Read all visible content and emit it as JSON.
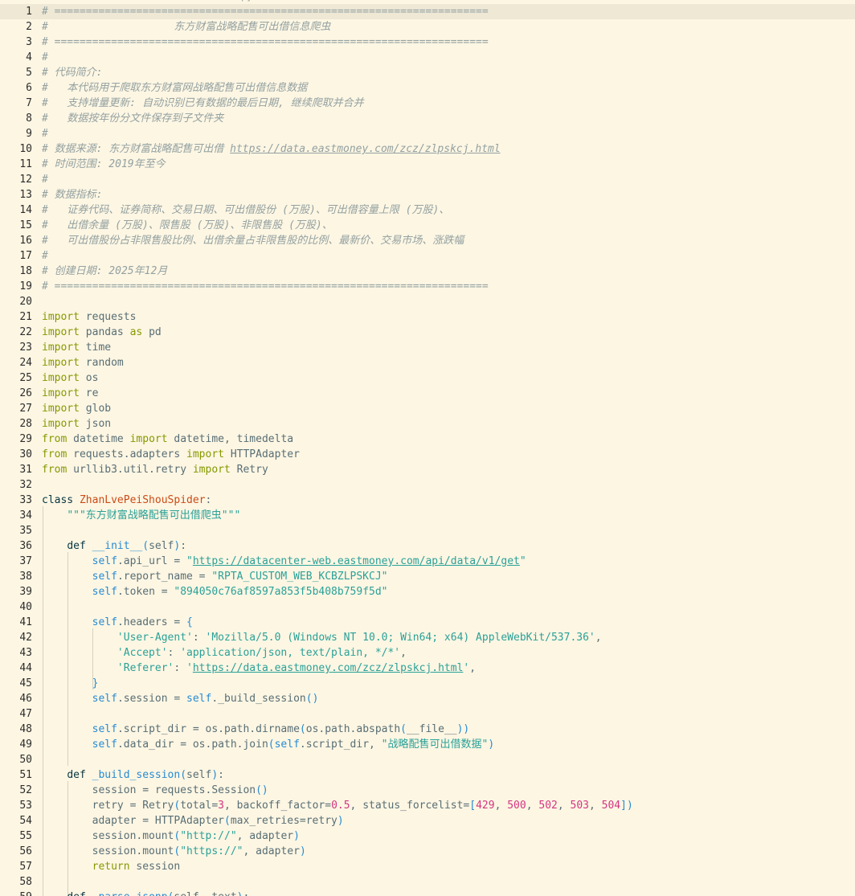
{
  "editor": {
    "language": "python",
    "current_line": 1,
    "top_fragment": "py",
    "lines": [
      [
        [
          "c",
          "# ====================================================================="
        ]
      ],
      [
        [
          "c",
          "#                    东方财富战略配售可出借信息爬虫"
        ]
      ],
      [
        [
          "c",
          "# ====================================================================="
        ]
      ],
      [
        [
          "c",
          "#"
        ]
      ],
      [
        [
          "c",
          "# 代码简介:"
        ]
      ],
      [
        [
          "c",
          "#   本代码用于爬取东方财富网战略配售可出借信息数据"
        ]
      ],
      [
        [
          "c",
          "#   支持增量更新: 自动识别已有数据的最后日期, 继续爬取并合并"
        ]
      ],
      [
        [
          "c",
          "#   数据按年份分文件保存到子文件夹"
        ]
      ],
      [
        [
          "c",
          "#"
        ]
      ],
      [
        [
          "c",
          "# 数据来源: 东方财富战略配售可出借 "
        ],
        [
          "cu",
          "https://data.eastmoney.com/zcz/zlpskcj.html"
        ]
      ],
      [
        [
          "c",
          "# 时间范围: 2019年至今"
        ]
      ],
      [
        [
          "c",
          "#"
        ]
      ],
      [
        [
          "c",
          "# 数据指标:"
        ]
      ],
      [
        [
          "c",
          "#   证券代码、证券简称、交易日期、可出借股份 (万股)、可出借容量上限 (万股)、"
        ]
      ],
      [
        [
          "c",
          "#   出借余量 (万股)、限售股 (万股)、非限售股 (万股)、"
        ]
      ],
      [
        [
          "c",
          "#   可出借股份占非限售股比例、出借余量占非限售股的比例、最新价、交易市场、涨跌幅"
        ]
      ],
      [
        [
          "c",
          "#"
        ]
      ],
      [
        [
          "c",
          "# 创建日期: 2025年12月"
        ]
      ],
      [
        [
          "c",
          "# ====================================================================="
        ]
      ],
      [],
      [
        [
          "k",
          "import"
        ],
        [
          "t",
          " requests"
        ]
      ],
      [
        [
          "k",
          "import"
        ],
        [
          "t",
          " pandas "
        ],
        [
          "k",
          "as"
        ],
        [
          "t",
          " pd"
        ]
      ],
      [
        [
          "k",
          "import"
        ],
        [
          "t",
          " time"
        ]
      ],
      [
        [
          "k",
          "import"
        ],
        [
          "t",
          " random"
        ]
      ],
      [
        [
          "k",
          "import"
        ],
        [
          "t",
          " os"
        ]
      ],
      [
        [
          "k",
          "import"
        ],
        [
          "t",
          " re"
        ]
      ],
      [
        [
          "k",
          "import"
        ],
        [
          "t",
          " glob"
        ]
      ],
      [
        [
          "k",
          "import"
        ],
        [
          "t",
          " json"
        ]
      ],
      [
        [
          "k",
          "from"
        ],
        [
          "t",
          " datetime "
        ],
        [
          "k",
          "import"
        ],
        [
          "t",
          " datetime, timedelta"
        ]
      ],
      [
        [
          "k",
          "from"
        ],
        [
          "t",
          " requests.adapters "
        ],
        [
          "k",
          "import"
        ],
        [
          "t",
          " HTTPAdapter"
        ]
      ],
      [
        [
          "k",
          "from"
        ],
        [
          "t",
          " urllib3.util.retry "
        ],
        [
          "k",
          "import"
        ],
        [
          "t",
          " Retry"
        ]
      ],
      [],
      [
        [
          "kw",
          "class "
        ],
        [
          "cls",
          "ZhanLvePeiShouSpider"
        ],
        [
          "t",
          ":"
        ]
      ],
      [
        [
          "t",
          "    "
        ],
        [
          "s",
          "\"\"\"东方财富战略配售可出借爬虫\"\"\""
        ]
      ],
      [],
      [
        [
          "t",
          "    "
        ],
        [
          "kw",
          "def "
        ],
        [
          "fn",
          "__init__"
        ],
        [
          "p",
          "("
        ],
        [
          "t",
          "self"
        ],
        [
          "p",
          ")"
        ],
        [
          "t",
          ":"
        ]
      ],
      [
        [
          "t",
          "        "
        ],
        [
          "self",
          "self"
        ],
        [
          "t",
          ".api_url = "
        ],
        [
          "s",
          "\""
        ],
        [
          "su",
          "https://datacenter-web.eastmoney.com/api/data/v1/get"
        ],
        [
          "s",
          "\""
        ]
      ],
      [
        [
          "t",
          "        "
        ],
        [
          "self",
          "self"
        ],
        [
          "t",
          ".report_name = "
        ],
        [
          "s",
          "\"RPTA_CUSTOM_WEB_KCBZLPSKCJ\""
        ]
      ],
      [
        [
          "t",
          "        "
        ],
        [
          "self",
          "self"
        ],
        [
          "t",
          ".token = "
        ],
        [
          "s",
          "\"894050c76af8597a853f5b408b759f5d\""
        ]
      ],
      [],
      [
        [
          "t",
          "        "
        ],
        [
          "self",
          "self"
        ],
        [
          "t",
          ".headers = "
        ],
        [
          "p",
          "{"
        ]
      ],
      [
        [
          "t",
          "            "
        ],
        [
          "s",
          "'User-Agent'"
        ],
        [
          "t",
          ": "
        ],
        [
          "s",
          "'Mozilla/5.0 (Windows NT 10.0; Win64; x64) AppleWebKit/537.36'"
        ],
        [
          "t",
          ","
        ]
      ],
      [
        [
          "t",
          "            "
        ],
        [
          "s",
          "'Accept'"
        ],
        [
          "t",
          ": "
        ],
        [
          "s",
          "'application/json, text/plain, */*'"
        ],
        [
          "t",
          ","
        ]
      ],
      [
        [
          "t",
          "            "
        ],
        [
          "s",
          "'Referer'"
        ],
        [
          "t",
          ": "
        ],
        [
          "s",
          "'"
        ],
        [
          "su",
          "https://data.eastmoney.com/zcz/zlpskcj.html"
        ],
        [
          "s",
          "'"
        ],
        [
          "t",
          ","
        ]
      ],
      [
        [
          "t",
          "        "
        ],
        [
          "p",
          "}"
        ]
      ],
      [
        [
          "t",
          "        "
        ],
        [
          "self",
          "self"
        ],
        [
          "t",
          ".session = "
        ],
        [
          "self",
          "self"
        ],
        [
          "t",
          "._build_session"
        ],
        [
          "p",
          "()"
        ]
      ],
      [],
      [
        [
          "t",
          "        "
        ],
        [
          "self",
          "self"
        ],
        [
          "t",
          ".script_dir = os.path.dirname"
        ],
        [
          "p",
          "("
        ],
        [
          "t",
          "os.path.abspath"
        ],
        [
          "p",
          "("
        ],
        [
          "t",
          "__file__"
        ],
        [
          "p",
          "))"
        ]
      ],
      [
        [
          "t",
          "        "
        ],
        [
          "self",
          "self"
        ],
        [
          "t",
          ".data_dir = os.path.join"
        ],
        [
          "p",
          "("
        ],
        [
          "self",
          "self"
        ],
        [
          "t",
          ".script_dir, "
        ],
        [
          "s",
          "\"战略配售可出借数据\""
        ],
        [
          "p",
          ")"
        ]
      ],
      [],
      [
        [
          "t",
          "    "
        ],
        [
          "kw",
          "def "
        ],
        [
          "fn",
          "_build_session"
        ],
        [
          "p",
          "("
        ],
        [
          "t",
          "self"
        ],
        [
          "p",
          ")"
        ],
        [
          "t",
          ":"
        ]
      ],
      [
        [
          "t",
          "        session = requests.Session"
        ],
        [
          "p",
          "()"
        ]
      ],
      [
        [
          "t",
          "        retry = Retry"
        ],
        [
          "p",
          "("
        ],
        [
          "t",
          "total="
        ],
        [
          "n",
          "3"
        ],
        [
          "t",
          ", backoff_factor="
        ],
        [
          "n",
          "0.5"
        ],
        [
          "t",
          ", status_forcelist="
        ],
        [
          "p",
          "["
        ],
        [
          "n",
          "429"
        ],
        [
          "t",
          ", "
        ],
        [
          "n",
          "500"
        ],
        [
          "t",
          ", "
        ],
        [
          "n",
          "502"
        ],
        [
          "t",
          ", "
        ],
        [
          "n",
          "503"
        ],
        [
          "t",
          ", "
        ],
        [
          "n",
          "504"
        ],
        [
          "p",
          "])"
        ]
      ],
      [
        [
          "t",
          "        adapter = HTTPAdapter"
        ],
        [
          "p",
          "("
        ],
        [
          "t",
          "max_retries=retry"
        ],
        [
          "p",
          ")"
        ]
      ],
      [
        [
          "t",
          "        session.mount"
        ],
        [
          "p",
          "("
        ],
        [
          "s",
          "\"http://\""
        ],
        [
          "t",
          ", adapter"
        ],
        [
          "p",
          ")"
        ]
      ],
      [
        [
          "t",
          "        session.mount"
        ],
        [
          "p",
          "("
        ],
        [
          "s",
          "\"https://\""
        ],
        [
          "t",
          ", adapter"
        ],
        [
          "p",
          ")"
        ]
      ],
      [
        [
          "t",
          "        "
        ],
        [
          "ret",
          "return"
        ],
        [
          "t",
          " session"
        ]
      ],
      [],
      [
        [
          "t",
          "    "
        ],
        [
          "kw",
          "def "
        ],
        [
          "fn",
          "_parse_jsonp"
        ],
        [
          "p",
          "("
        ],
        [
          "t",
          "self, text"
        ],
        [
          "p",
          ")"
        ],
        [
          "t",
          ":"
        ]
      ]
    ]
  }
}
